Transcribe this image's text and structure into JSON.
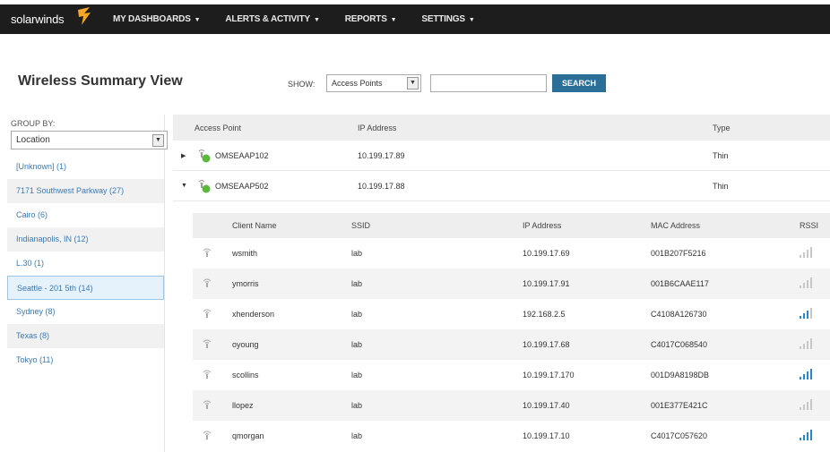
{
  "app": {
    "brand": "solarwinds",
    "nav": [
      {
        "label": "MY DASHBOARDS"
      },
      {
        "label": "ALERTS & ACTIVITY"
      },
      {
        "label": "REPORTS"
      },
      {
        "label": "SETTINGS"
      }
    ],
    "caret": "▼"
  },
  "page": {
    "title": "Wireless Summary View",
    "show_label": "SHOW:",
    "show_value": "Access Points",
    "search_value": "",
    "search_button": "SEARCH"
  },
  "sidebar": {
    "group_by_label": "GROUP BY:",
    "group_by_value": "Location",
    "items": [
      {
        "label": "[Unknown] (1)"
      },
      {
        "label": "7171 Southwest Parkway (27)"
      },
      {
        "label": "Cairo (6)"
      },
      {
        "label": "Indianapolis, IN (12)"
      },
      {
        "label": "L.30 (1)"
      },
      {
        "label": "Seattle - 201 5th (14)"
      },
      {
        "label": "Sydney (8)"
      },
      {
        "label": "Texas (8)"
      },
      {
        "label": "Tokyo (11)"
      }
    ],
    "selected_index": 5
  },
  "access_points": {
    "columns": {
      "name": "Access Point",
      "ip": "IP Address",
      "type": "Type"
    },
    "rows": [
      {
        "name": "OMSEAAP102",
        "ip": "10.199.17.89",
        "type": "Thin",
        "expanded": false,
        "status_color": "#5cb83c"
      },
      {
        "name": "OMSEAAP502",
        "ip": "10.199.17.88",
        "type": "Thin",
        "expanded": true,
        "status_color": "#5cb83c"
      }
    ]
  },
  "clients": {
    "columns": {
      "name": "Client Name",
      "ssid": "SSID",
      "ip": "IP Address",
      "mac": "MAC Address",
      "rssi": "RSSI"
    },
    "rows": [
      {
        "name": "wsmith",
        "ssid": "lab",
        "ip": "10.199.17.69",
        "mac": "001B207F5216",
        "signal": 0
      },
      {
        "name": "ymorris",
        "ssid": "lab",
        "ip": "10.199.17.91",
        "mac": "001B6CAAE117",
        "signal": 0
      },
      {
        "name": "xhenderson",
        "ssid": "lab",
        "ip": "192.168.2.5",
        "mac": "C4108A126730",
        "signal": 3
      },
      {
        "name": "oyoung",
        "ssid": "lab",
        "ip": "10.199.17.68",
        "mac": "C4017C068540",
        "signal": 0
      },
      {
        "name": "scollins",
        "ssid": "lab",
        "ip": "10.199.17.170",
        "mac": "001D9A8198DB",
        "signal": 4
      },
      {
        "name": "llopez",
        "ssid": "lab",
        "ip": "10.199.17.40",
        "mac": "001E377E421C",
        "signal": 0
      },
      {
        "name": "qmorgan",
        "ssid": "lab",
        "ip": "10.199.17.10",
        "mac": "C4017C057620",
        "signal": 4
      }
    ]
  },
  "colors": {
    "topbar": "#1d1d1d",
    "accent": "#2b6f98",
    "link": "#3b7ab5",
    "logo_orange": "#f5a623",
    "signal_on": "#2b88c8",
    "signal_off": "#c8c8c8"
  }
}
